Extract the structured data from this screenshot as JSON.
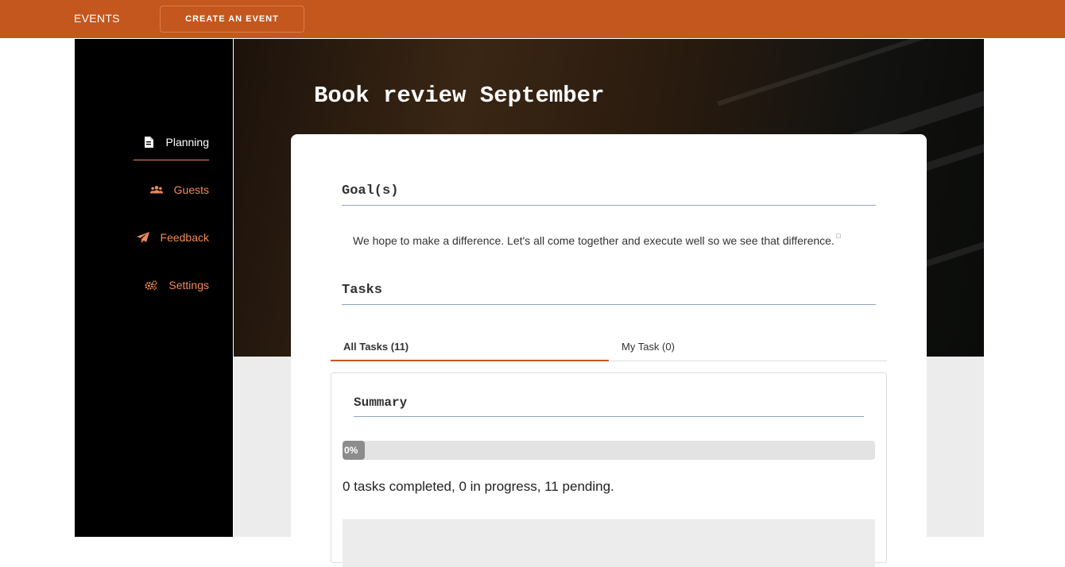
{
  "header": {
    "brand": "EVENTS",
    "create_button": "CREATE AN EVENT"
  },
  "sidebar": {
    "items": [
      {
        "label": "Planning",
        "icon": "document-icon",
        "active": true
      },
      {
        "label": "Guests",
        "icon": "users-icon",
        "active": false
      },
      {
        "label": "Feedback",
        "icon": "paper-plane-icon",
        "active": false
      },
      {
        "label": "Settings",
        "icon": "gears-icon",
        "active": false
      }
    ]
  },
  "event": {
    "title": "Book review September"
  },
  "goals": {
    "heading": "Goal(s)",
    "text": "We hope to make a difference. Let's all come together and execute well so we see that difference."
  },
  "tasks": {
    "heading": "Tasks",
    "tabs": [
      {
        "label": "All Tasks (11)",
        "active": true
      },
      {
        "label": "My Task (0)",
        "active": false
      }
    ]
  },
  "summary": {
    "heading": "Summary",
    "progress_label": "0%",
    "progress_value": 0,
    "status_text": "0 tasks completed, 0 in progress, 11 pending."
  },
  "colors": {
    "brand": "#c4571e",
    "accent": "#ef8a57",
    "rule": "#8ea3bf"
  }
}
